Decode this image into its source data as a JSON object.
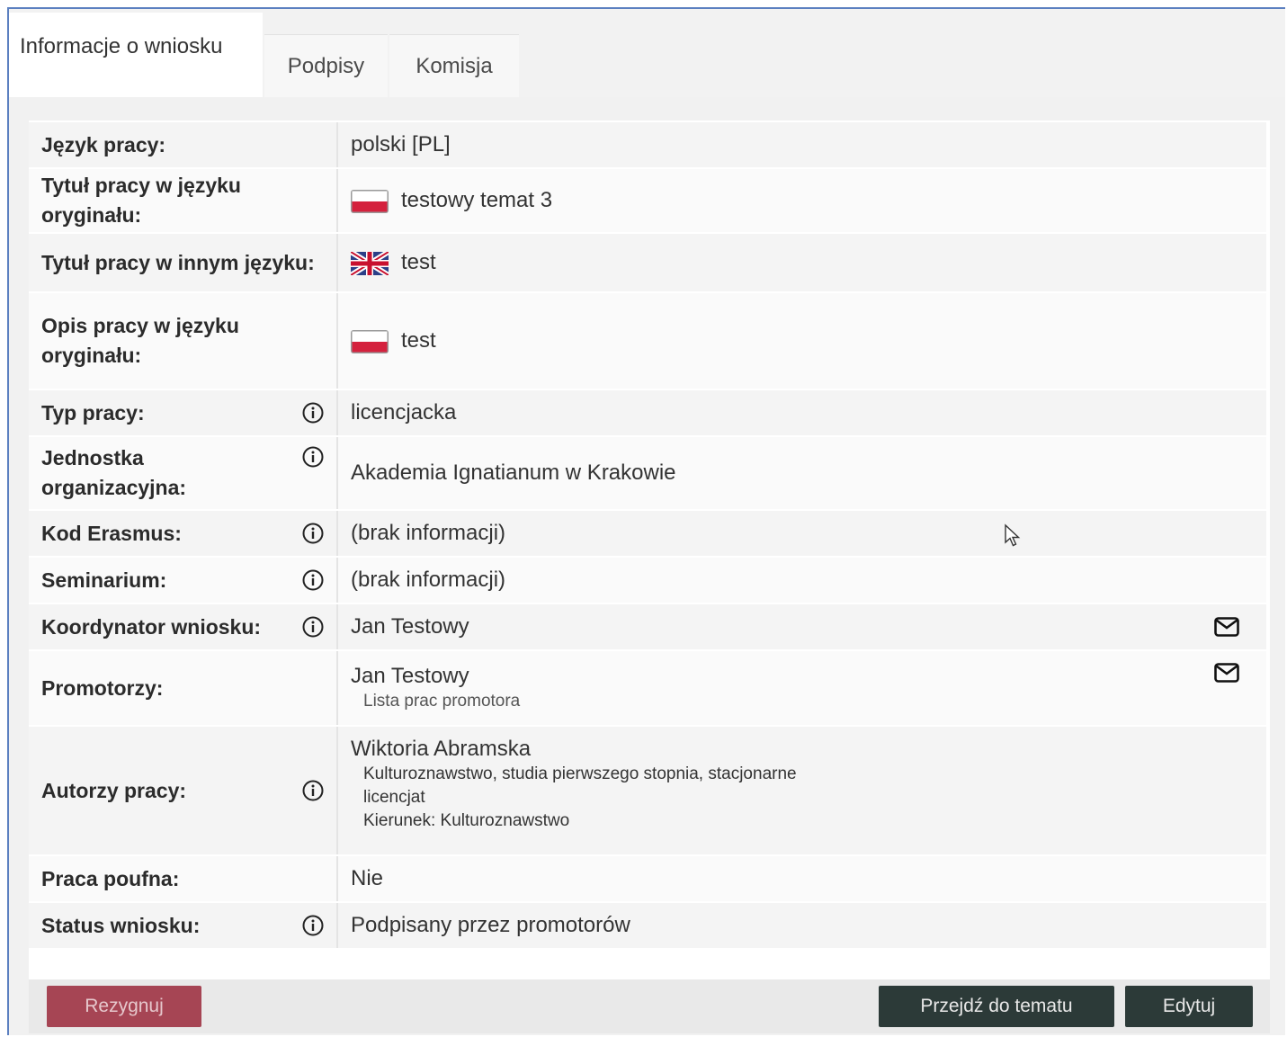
{
  "tabs": [
    {
      "label": "Informacje o wniosku",
      "active": true
    },
    {
      "label": "Podpisy",
      "active": false
    },
    {
      "label": "Komisja",
      "active": false
    }
  ],
  "rows": {
    "jezyk": {
      "label": "Język pracy:",
      "value": "polski [PL]"
    },
    "tytul_oryg": {
      "label": "Tytuł pracy w języku oryginału:",
      "value": "testowy temat 3",
      "flag": "pl-flag-icon"
    },
    "tytul_inny": {
      "label": "Tytuł pracy w innym języku:",
      "value": "test",
      "flag": "uk-flag-icon"
    },
    "opis_oryg": {
      "label": "Opis pracy w języku oryginału:",
      "value": "test",
      "flag": "pl-flag-icon"
    },
    "typ": {
      "label": "Typ pracy:",
      "value": "licencjacka"
    },
    "jednostka": {
      "label": "Jednostka organizacyjna:",
      "value": "Akademia Ignatianum w Krakowie"
    },
    "erasmus": {
      "label": "Kod Erasmus:",
      "value": "(brak informacji)"
    },
    "seminarium": {
      "label": "Seminarium:",
      "value": "(brak informacji)"
    },
    "koordynator": {
      "label": "Koordynator wniosku:",
      "value": "Jan Testowy"
    },
    "promotorzy": {
      "label": "Promotorzy:",
      "value": "Jan Testowy",
      "link": "Lista prac promotora"
    },
    "autorzy": {
      "label": "Autorzy pracy:",
      "name": "Wiktoria Abramska",
      "line1": "Kulturoznawstwo, studia pierwszego stopnia, stacjonarne",
      "line2": "licencjat",
      "line3": "Kierunek: Kulturoznawstwo"
    },
    "poufna": {
      "label": "Praca poufna:",
      "value": "Nie"
    },
    "status": {
      "label": "Status wniosku:",
      "value": "Podpisany przez promotorów"
    }
  },
  "buttons": {
    "cancel": "Rezygnuj",
    "go_topic": "Przejdź do tematu",
    "edit": "Edytuj"
  },
  "colors": {
    "accent_dark": "#2c3a38",
    "cancel_red": "#a64554",
    "no_info": "#b3753a"
  },
  "icons": {
    "info": "info-circle-icon",
    "mail": "envelope-icon"
  }
}
